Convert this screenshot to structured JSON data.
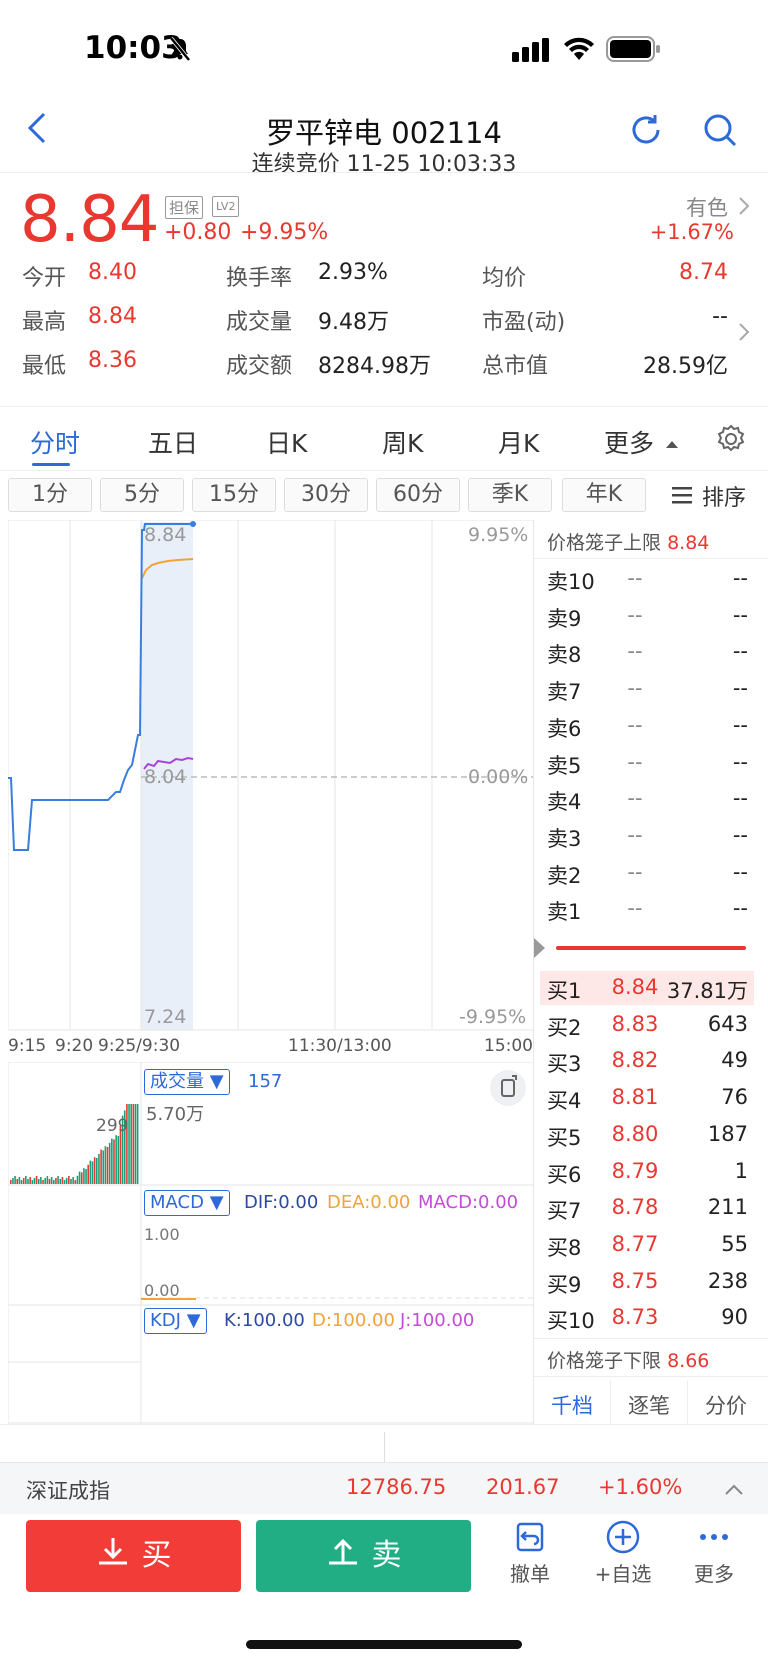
{
  "status_bar": {
    "time": "10:03"
  },
  "header": {
    "title": "罗平锌电 002114",
    "subtitle": "连续竞价 11-25 10:03:33"
  },
  "quote": {
    "price": "8.84",
    "change": "+0.80",
    "change_pct": "+9.95%",
    "tag1": "担保",
    "tag2": "LV2",
    "sector_name": "有色",
    "sector_pct": "+1.67%"
  },
  "stats": [
    {
      "label": "今开",
      "value": "8.40"
    },
    {
      "label": "换手率",
      "value": "2.93%"
    },
    {
      "label": "均价",
      "value": "8.74"
    },
    {
      "label": "最高",
      "value": "8.84"
    },
    {
      "label": "成交量",
      "value": "9.48万"
    },
    {
      "label": "市盈(动)",
      "value": "--"
    },
    {
      "label": "最低",
      "value": "8.36"
    },
    {
      "label": "成交额",
      "value": "8284.98万"
    },
    {
      "label": "总市值",
      "value": "28.59亿"
    }
  ],
  "tabs": [
    "分时",
    "五日",
    "日K",
    "周K",
    "月K",
    "更多"
  ],
  "periods": [
    "1分",
    "5分",
    "15分",
    "30分",
    "60分",
    "季K",
    "年K"
  ],
  "sort_label": "排序",
  "chart": {
    "price_high": "8.84",
    "price_mid": "8.04",
    "price_low": "7.24",
    "pct_high": "9.95%",
    "pct_mid": "0.00%",
    "pct_low": "-9.95%",
    "time_labels": [
      "9:15",
      "9:20",
      "9:25/9:30",
      "11:30/13:00",
      "15:00"
    ],
    "colors": {
      "price_line": "#3a7de0",
      "avg_line": "#f0a33a",
      "auction_line": "#a845d8"
    }
  },
  "volume_panel": {
    "label": "成交量",
    "value": "157",
    "max_label": "5.70万",
    "auction_label": "299"
  },
  "macd_panel": {
    "label": "MACD",
    "dif": "DIF:0.00",
    "dea": "DEA:0.00",
    "macd": "MACD:0.00",
    "top": "1.00",
    "zero": "0.00"
  },
  "kdj_panel": {
    "label": "KDJ",
    "k": "K:100.00",
    "d": "D:100.00",
    "j": "J:100.00"
  },
  "order_book": {
    "upper_limit_label": "价格笼子上限",
    "upper_limit": "8.84",
    "lower_limit_label": "价格笼子下限",
    "lower_limit": "8.66",
    "asks": [
      {
        "label": "卖10",
        "price": "--",
        "vol": "--"
      },
      {
        "label": "卖9",
        "price": "--",
        "vol": "--"
      },
      {
        "label": "卖8",
        "price": "--",
        "vol": "--"
      },
      {
        "label": "卖7",
        "price": "--",
        "vol": "--"
      },
      {
        "label": "卖6",
        "price": "--",
        "vol": "--"
      },
      {
        "label": "卖5",
        "price": "--",
        "vol": "--"
      },
      {
        "label": "卖4",
        "price": "--",
        "vol": "--"
      },
      {
        "label": "卖3",
        "price": "--",
        "vol": "--"
      },
      {
        "label": "卖2",
        "price": "--",
        "vol": "--"
      },
      {
        "label": "卖1",
        "price": "--",
        "vol": "--"
      }
    ],
    "bids": [
      {
        "label": "买1",
        "price": "8.84",
        "vol": "37.81万"
      },
      {
        "label": "买2",
        "price": "8.83",
        "vol": "643"
      },
      {
        "label": "买3",
        "price": "8.82",
        "vol": "49"
      },
      {
        "label": "买4",
        "price": "8.81",
        "vol": "76"
      },
      {
        "label": "买5",
        "price": "8.80",
        "vol": "187"
      },
      {
        "label": "买6",
        "price": "8.79",
        "vol": "1"
      },
      {
        "label": "买7",
        "price": "8.78",
        "vol": "211"
      },
      {
        "label": "买8",
        "price": "8.77",
        "vol": "55"
      },
      {
        "label": "买9",
        "price": "8.75",
        "vol": "238"
      },
      {
        "label": "买10",
        "price": "8.73",
        "vol": "90"
      }
    ],
    "tabs": [
      "千档",
      "逐笔",
      "分价"
    ]
  },
  "index_bar": {
    "name": "深证成指",
    "value": "12786.75",
    "change": "201.67",
    "pct": "+1.60%"
  },
  "actions": {
    "buy": "买",
    "sell": "卖",
    "cancel": "撤单",
    "watchlist": "+自选",
    "more": "更多"
  }
}
